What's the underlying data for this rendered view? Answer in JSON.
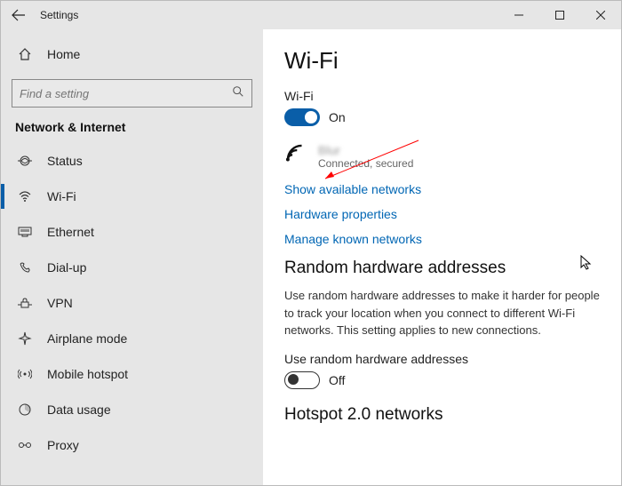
{
  "titlebar": {
    "title": "Settings"
  },
  "sidebar": {
    "home_label": "Home",
    "search_placeholder": "Find a setting",
    "section": "Network & Internet",
    "items": [
      {
        "label": "Status"
      },
      {
        "label": "Wi-Fi"
      },
      {
        "label": "Ethernet"
      },
      {
        "label": "Dial-up"
      },
      {
        "label": "VPN"
      },
      {
        "label": "Airplane mode"
      },
      {
        "label": "Mobile hotspot"
      },
      {
        "label": "Data usage"
      },
      {
        "label": "Proxy"
      }
    ]
  },
  "main": {
    "heading": "Wi-Fi",
    "wifi_label": "Wi-Fi",
    "wifi_state": "On",
    "connection": {
      "ssid": "Blur",
      "status": "Connected, secured"
    },
    "links": {
      "show_networks": "Show available networks",
      "hw_props": "Hardware properties",
      "manage_known": "Manage known networks"
    },
    "random": {
      "heading": "Random hardware addresses",
      "desc": "Use random hardware addresses to make it harder for people to track your location when you connect to different Wi-Fi networks. This setting applies to new connections.",
      "toggle_label": "Use random hardware addresses",
      "toggle_state": "Off"
    },
    "cutoff": "Hotspot 2.0 networks"
  }
}
